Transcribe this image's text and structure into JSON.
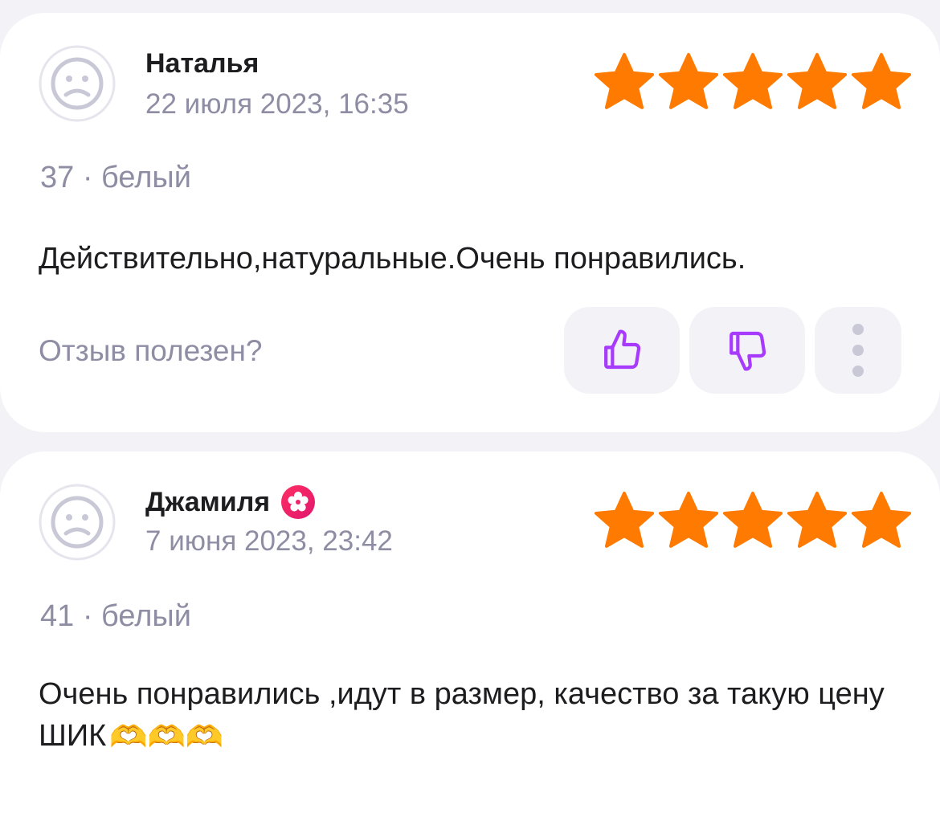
{
  "reviews": [
    {
      "author": "Наталья",
      "date": "22 июля 2023, 16:35",
      "rating": 5,
      "meta": "37 · белый",
      "text": "Действительно,натуральные.Очень понравились.",
      "verified_badge": false
    },
    {
      "author": "Джамиля",
      "date": "7 июня 2023, 23:42",
      "rating": 5,
      "meta": "41 · белый",
      "text": "Очень понравились ,идут в размер, качество за такую цену ШИК",
      "emoji": "🫶🫶🫶",
      "verified_badge": true
    }
  ],
  "helpful_prompt": "Отзыв полезен?",
  "icons": {
    "avatar": "sad-face-avatar-icon",
    "star": "star-icon",
    "like": "thumbs-up-icon",
    "dislike": "thumbs-down-icon",
    "more": "more-vertical-icon",
    "badge": "flower-badge-icon",
    "emoji": "heart-hands-emoji"
  },
  "colors": {
    "background": "#F2F2F7",
    "card": "#FFFFFF",
    "star": "#FF7A00",
    "secondary_text": "#8E8DA4",
    "vote_icon": "#A73AFD",
    "badge_gradient_start": "#FF2E63",
    "badge_gradient_end": "#E0176E"
  }
}
